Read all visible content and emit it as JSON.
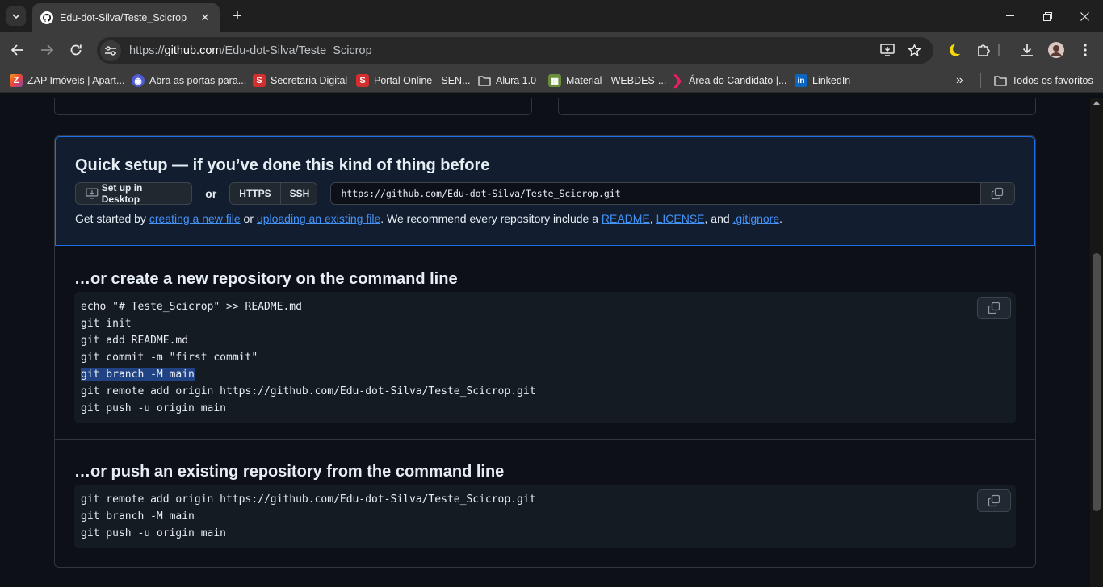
{
  "browser": {
    "tab_title": "Edu-dot-Silva/Teste_Scicrop",
    "url_prefix": "https://",
    "url_domain": "github.com",
    "url_path": "/Edu-dot-Silva/Teste_Scicrop",
    "icons": [
      "tab-list-icon",
      "github-icon",
      "close-icon",
      "plus-icon",
      "minimize-icon",
      "restore-icon",
      "back-icon",
      "forward-icon",
      "reload-icon",
      "tune-icon",
      "install-app-icon",
      "star-icon",
      "moon-icon",
      "extensions-icon",
      "download-icon",
      "profile-avatar",
      "menu-icon"
    ]
  },
  "bookmarks": [
    {
      "label": "ZAP Imóveis | Apart...",
      "color": "#e8453c",
      "glyph": "Z"
    },
    {
      "label": "Abra as portas para...",
      "color": "#4f5bd5",
      "glyph": "◉"
    },
    {
      "label": "Secretaria Digital",
      "color": "#d32f2f",
      "glyph": "S"
    },
    {
      "label": "Portal Online - SEN...",
      "color": "#d32f2f",
      "glyph": "S"
    },
    {
      "label": "Alura 1.0",
      "color": "",
      "glyph": "folder"
    },
    {
      "label": "Material - WEBDES-...",
      "color": "#6a8d3a",
      "glyph": "▦"
    },
    {
      "label": "Área do Candidato |...",
      "color": "#e91e63",
      "glyph": "❯"
    },
    {
      "label": "LinkedIn",
      "color": "#0a66c2",
      "glyph": "in"
    }
  ],
  "bookmarks_more": "»",
  "all_bookmarks": "Todos os favoritos",
  "quick_setup": {
    "title": "Quick setup — if you’ve done this kind of thing before",
    "desktop_button": "Set up in Desktop",
    "or": "or",
    "https": "HTTPS",
    "ssh": "SSH",
    "clone_url": "https://github.com/Edu-dot-Silva/Teste_Scicrop.git",
    "text_1": "Get started by ",
    "link_new_file": "creating a new file",
    "text_2": " or ",
    "link_upload": "uploading an existing file",
    "text_3": ". We recommend every repository include a ",
    "link_readme": "README",
    "text_4": ", ",
    "link_license": "LICENSE",
    "text_5": ", and ",
    "link_gitignore": ".gitignore",
    "text_6": "."
  },
  "new_repo": {
    "title": "…or create a new repository on the command line",
    "lines": [
      "echo \"# Teste_Scicrop\" >> README.md",
      "git init",
      "git add README.md",
      "git commit -m \"first commit\"",
      "git branch -M main",
      "git remote add origin https://github.com/Edu-dot-Silva/Teste_Scicrop.git",
      "git push -u origin main"
    ],
    "selected_line": "git branch -M main"
  },
  "push_existing": {
    "title": "…or push an existing repository from the command line",
    "lines": [
      "git remote add origin https://github.com/Edu-dot-Silva/Teste_Scicrop.git",
      "git branch -M main",
      "git push -u origin main"
    ]
  }
}
